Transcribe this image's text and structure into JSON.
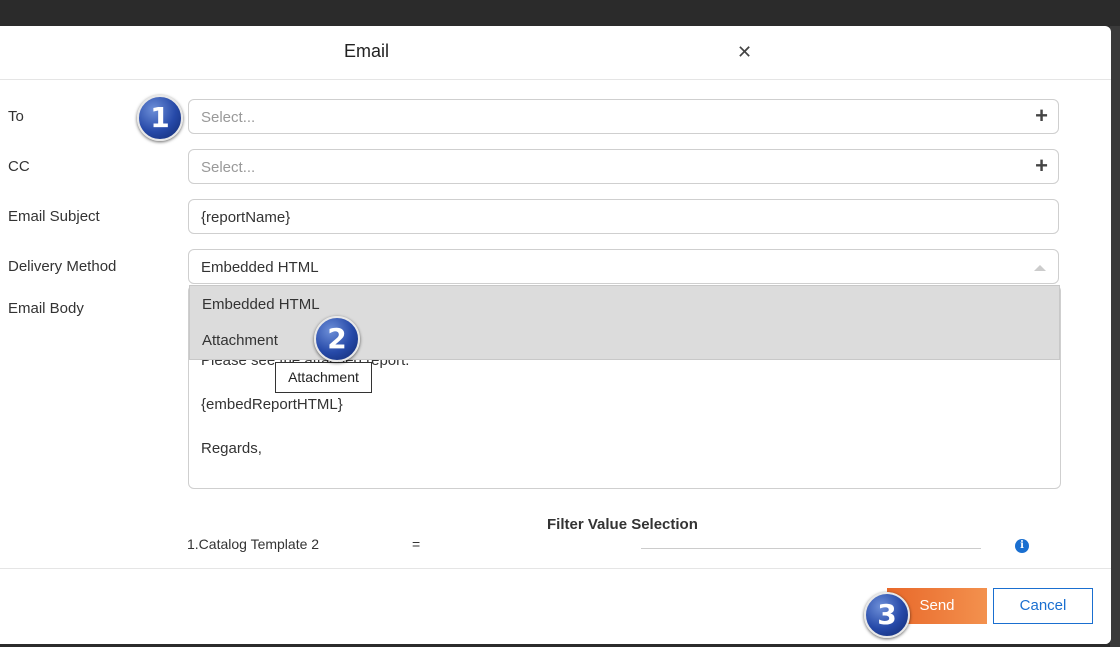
{
  "modal": {
    "title": "Email",
    "close_icon": "close-icon"
  },
  "form": {
    "to": {
      "label": "To",
      "placeholder": "Select..."
    },
    "cc": {
      "label": "CC",
      "placeholder": "Select..."
    },
    "subject": {
      "label": "Email Subject",
      "value": "{reportName}"
    },
    "delivery": {
      "label": "Delivery Method",
      "value": "Embedded HTML",
      "options": [
        "Embedded HTML",
        "Attachment"
      ]
    },
    "body": {
      "label": "Email Body",
      "lines": [
        "Please see the attached report.",
        "{embedReportHTML}",
        "Regards,"
      ]
    }
  },
  "tooltip": {
    "text": "Attachment"
  },
  "filter": {
    "title": "Filter Value Selection",
    "row_label": "1.Catalog Template 2",
    "operator": "=",
    "info_icon": "info-icon"
  },
  "footer": {
    "send_label": "Send",
    "cancel_label": "Cancel"
  },
  "callouts": [
    "1",
    "2",
    "3"
  ],
  "colors": {
    "send_gradient_start": "#e8682a",
    "send_gradient_end": "#f3914e",
    "cancel_accent": "#1a6fd0",
    "badge_blue": "#2649a8"
  }
}
